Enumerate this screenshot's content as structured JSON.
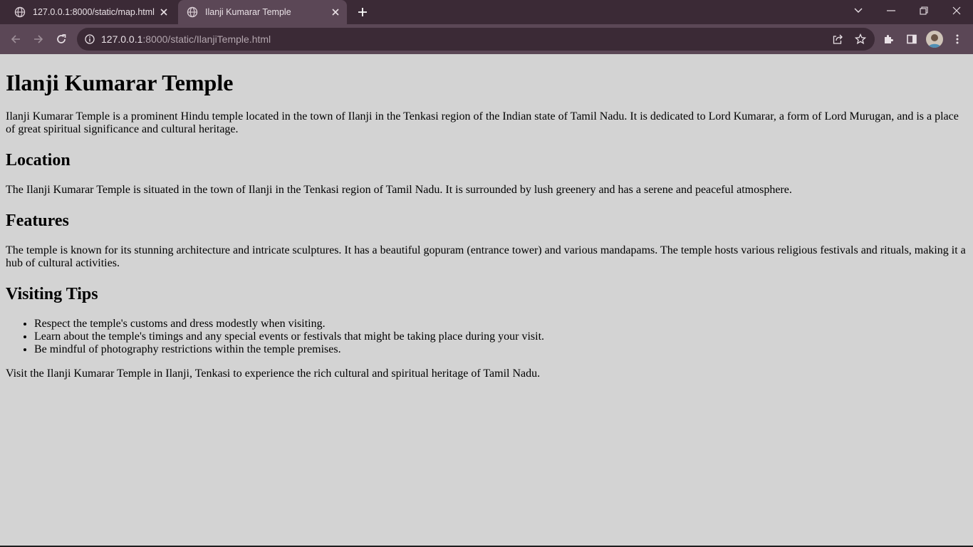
{
  "browser": {
    "tabs": [
      {
        "title": "127.0.0.1:8000/static/map.html",
        "active": false
      },
      {
        "title": "Ilanji Kumarar Temple",
        "active": true
      }
    ],
    "url_host": "127.0.0.1",
    "url_rest": ":8000/static/IlanjiTemple.html"
  },
  "page": {
    "title": "Ilanji Kumarar Temple",
    "intro": "Ilanji Kumarar Temple is a prominent Hindu temple located in the town of Ilanji in the Tenkasi region of the Indian state of Tamil Nadu. It is dedicated to Lord Kumarar, a form of Lord Murugan, and is a place of great spiritual significance and cultural heritage.",
    "sections": [
      {
        "heading": "Location",
        "text": "The Ilanji Kumarar Temple is situated in the town of Ilanji in the Tenkasi region of Tamil Nadu. It is surrounded by lush greenery and has a serene and peaceful atmosphere."
      },
      {
        "heading": "Features",
        "text": "The temple is known for its stunning architecture and intricate sculptures. It has a beautiful gopuram (entrance tower) and various mandapams. The temple hosts various religious festivals and rituals, making it a hub of cultural activities."
      },
      {
        "heading": "Visiting Tips",
        "items": [
          "Respect the temple's customs and dress modestly when visiting.",
          "Learn about the temple's timings and any special events or festivals that might be taking place during your visit.",
          "Be mindful of photography restrictions within the temple premises."
        ]
      }
    ],
    "closing": "Visit the Ilanji Kumarar Temple in Ilanji, Tenkasi to experience the rich cultural and spiritual heritage of Tamil Nadu."
  },
  "colors": {
    "page_background": "#d3d3d3",
    "tabbar_background": "#3b2a36",
    "toolbar_background": "#5b4756"
  }
}
